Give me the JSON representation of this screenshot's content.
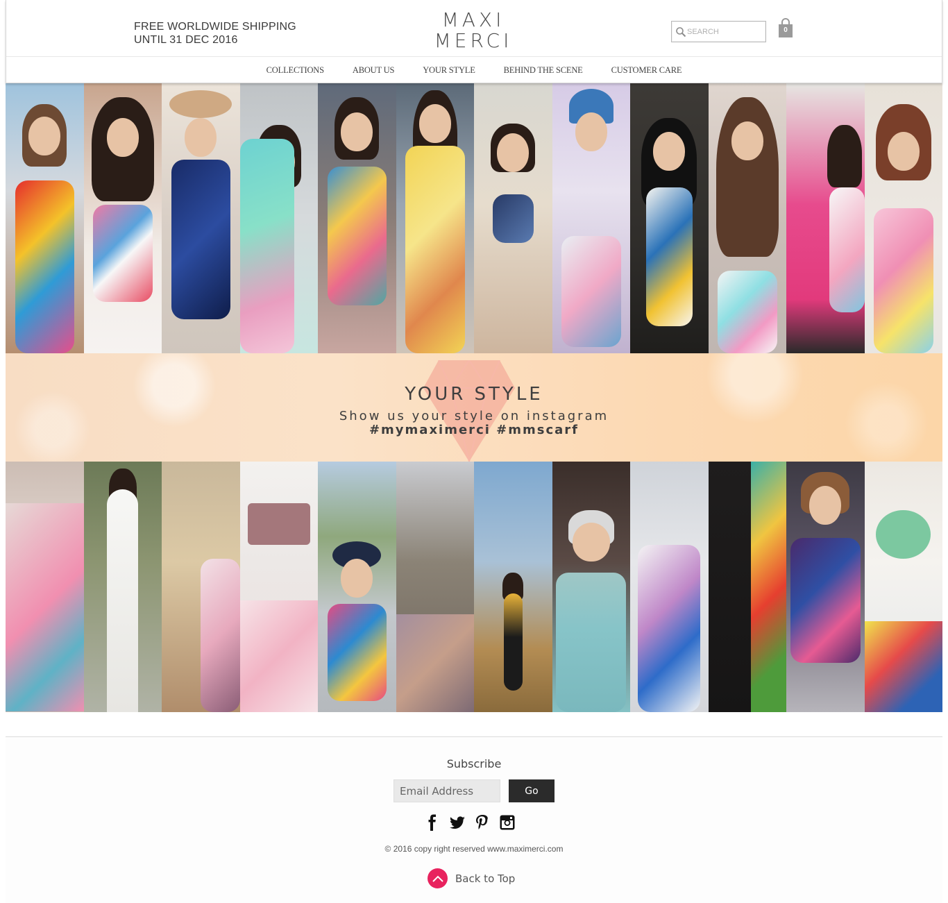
{
  "header": {
    "shipping_line1": "FREE WORLDWIDE SHIPPING",
    "shipping_line2": "UNTIL 31 DEC 2016",
    "logo_line1": "MAXI",
    "logo_line2": "MERCI",
    "search_placeholder": "SEARCH",
    "cart_count": "0",
    "icons": {
      "search": "search-icon",
      "cart": "shopping-bag-icon"
    }
  },
  "nav": {
    "items": [
      {
        "label": "COLLECTIONS"
      },
      {
        "label": "ABOUT US"
      },
      {
        "label": "YOUR STYLE"
      },
      {
        "label": "BEHIND THE SCENE"
      },
      {
        "label": "CUSTOMER CARE"
      }
    ]
  },
  "banner": {
    "title": "YOUR STYLE",
    "subtitle": "Show us your style on instagram",
    "hashtags": "#mymaximerci #mmscarf",
    "icon": "diamond-icon"
  },
  "footer": {
    "subscribe_title": "Subscribe",
    "email_placeholder": "Email Address",
    "go_label": "Go",
    "socials": [
      "facebook-icon",
      "twitter-icon",
      "pinterest-icon",
      "instagram-icon"
    ],
    "copyright": "© 2016 copy right reserved www.maximerci.com",
    "back_to_top": "Back to Top"
  },
  "colors": {
    "accent_pink": "#e8235e",
    "button_dark": "#2b2b2b",
    "banner_peach": "#fbe0c5"
  }
}
